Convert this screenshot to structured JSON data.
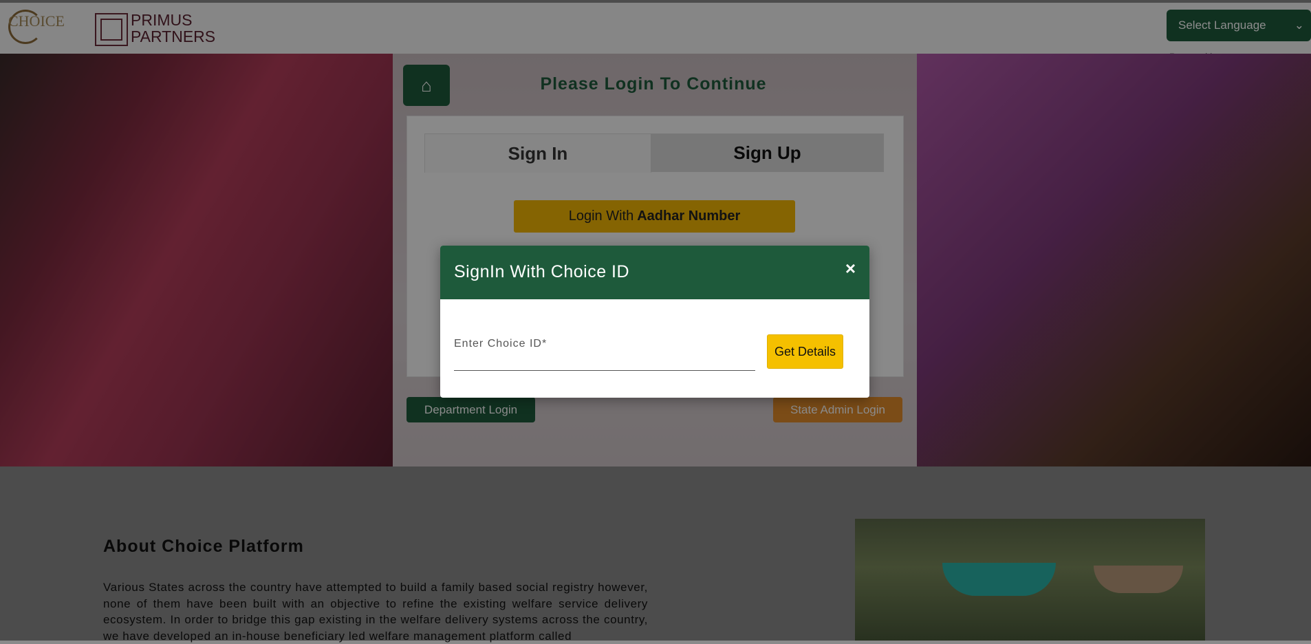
{
  "header": {
    "choice_logo_text": "CHOICE",
    "primus_line1": "PRIMUS",
    "primus_line2": "PARTNERS",
    "language_select": "Select Language",
    "powered_by": "Powered by"
  },
  "login": {
    "title": "Please Login To Continue",
    "tab_signin": "Sign In",
    "tab_signup": "Sign Up",
    "aadhar_prefix": "Login With",
    "aadhar_bold": "Aadhar Number",
    "department_login": "Department Login",
    "state_admin_login": "State Admin Login"
  },
  "modal": {
    "title": "SignIn With Choice ID",
    "close": "×",
    "input_label": "Enter Choice ID*",
    "button": "Get Details"
  },
  "about": {
    "heading": "About Choice Platform",
    "body": "Various States across the country have attempted to build a family based social registry however, none of them have been built with an objective to refine the existing welfare service delivery ecosystem. In order to bridge this gap existing in the welfare delivery systems across the country, we have developed an in-house beneficiary led welfare management platform called"
  },
  "colors": {
    "brand_green": "#1e5a3b",
    "accent_yellow": "#f5c000",
    "accent_orange": "#e08a2a"
  }
}
